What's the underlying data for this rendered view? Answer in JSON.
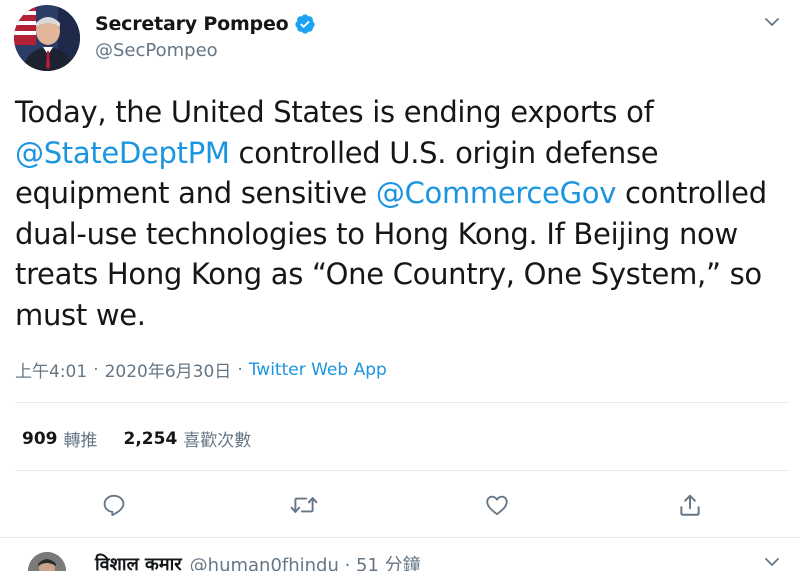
{
  "tweet": {
    "author": {
      "display_name": "Secretary Pompeo",
      "handle": "@SecPompeo",
      "verified_icon": "verified-badge-icon"
    },
    "text": {
      "part1": "Today, the United States is ending exports of ",
      "mention1": "@StateDeptPM",
      "part2": " controlled U.S. origin defense equipment and sensitive ",
      "mention2": "@CommerceGov",
      "part3": " controlled dual-use technologies to Hong Kong. If Beijing now treats Hong Kong as “One Country, One System,” so must we."
    },
    "meta": {
      "time": "上午4:01",
      "separator": "·",
      "date": "2020年6月30日",
      "separator2": "·",
      "source": "Twitter Web App"
    },
    "stats": {
      "retweets_count": "909",
      "retweets_label": "轉推",
      "likes_count": "2,254",
      "likes_label": "喜歡次數"
    },
    "actions": [
      "reply-icon",
      "retweet-icon",
      "like-icon",
      "share-icon"
    ]
  },
  "reply": {
    "display_name": "विशाल कमार",
    "handle": "@human0fhindu · 51 分鐘"
  },
  "colors": {
    "accent": "#1b95e0",
    "secondary_text": "#657786",
    "divider": "#e6ecf0",
    "icon_gray": "#657786"
  }
}
